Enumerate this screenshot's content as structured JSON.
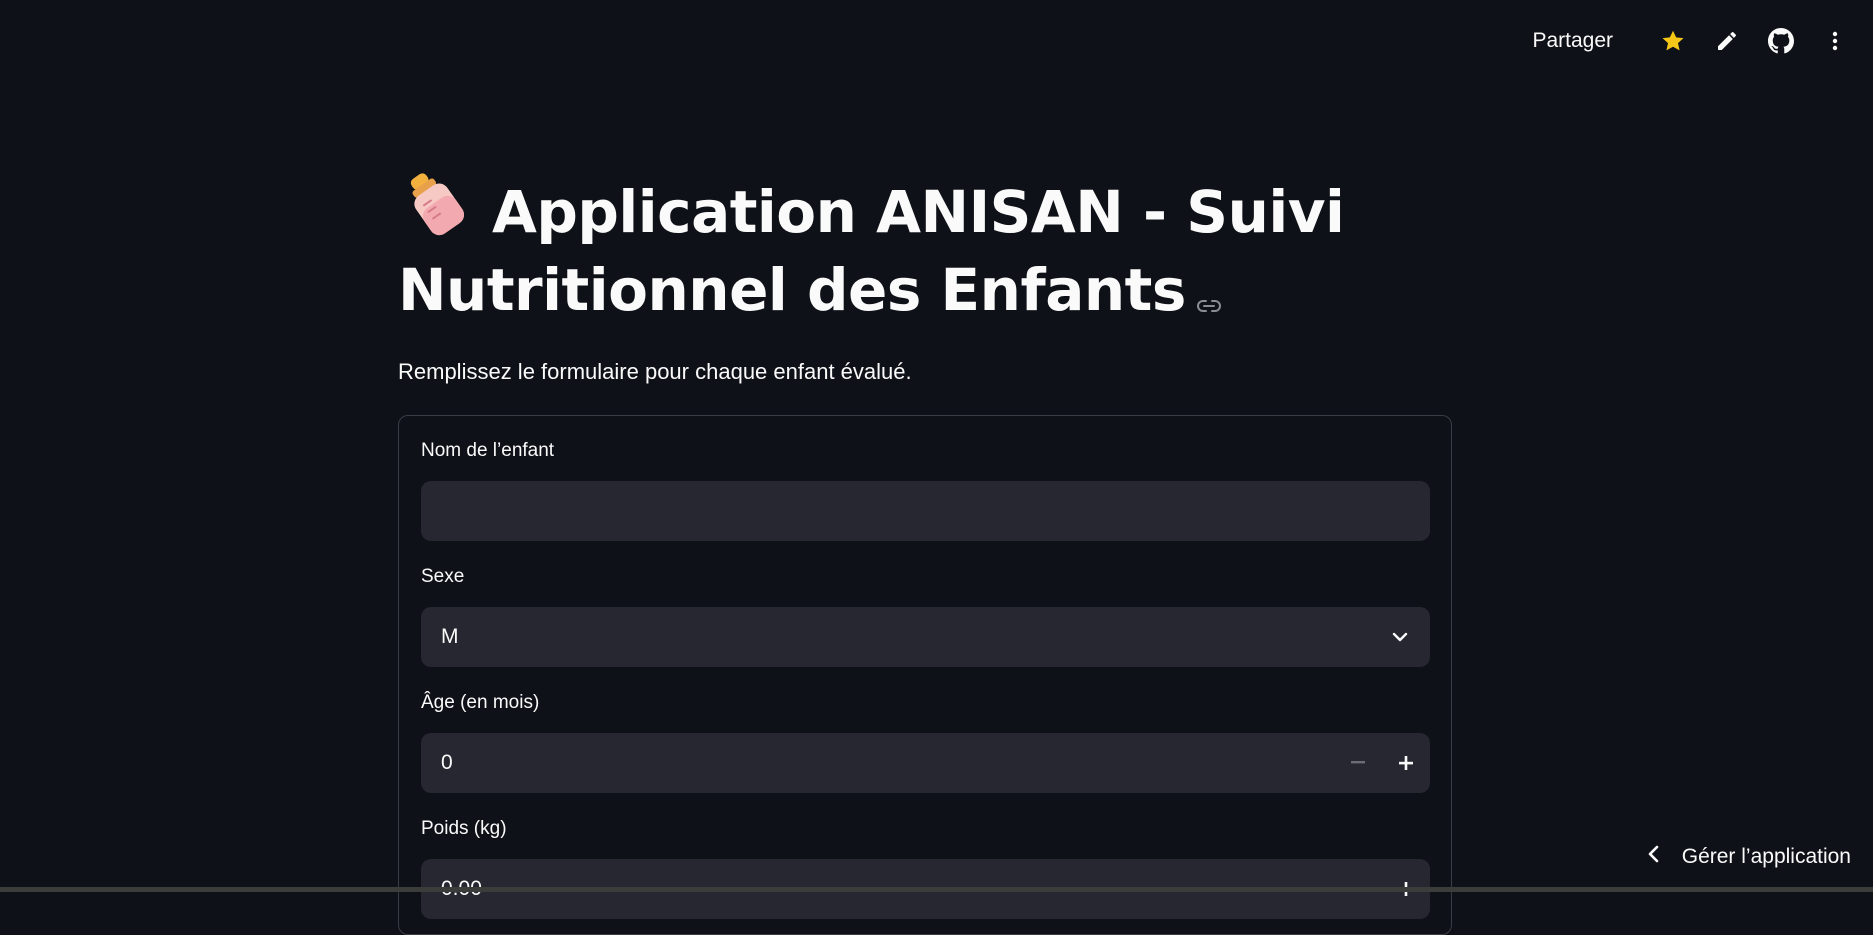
{
  "toolbar": {
    "share_label": "Partager",
    "icons": [
      "star-icon",
      "edit-icon",
      "github-icon",
      "more-vertical-icon"
    ],
    "star_color": "#f5c518"
  },
  "page": {
    "title_line1": "Application ANISAN - Suivi",
    "title_line2": "Nutritionnel des Enfants",
    "subtitle": "Remplissez le formulaire pour chaque enfant évalué."
  },
  "form": {
    "name_label": "Nom de l’enfant",
    "name_value": "",
    "sex_label": "Sexe",
    "sex_value": "M",
    "age_label": "Âge (en mois)",
    "age_value": "0",
    "weight_label": "Poids (kg)",
    "weight_value": "0.00"
  },
  "footer": {
    "manage_label": "Gérer l’application"
  },
  "colors": {
    "background": "#0e1117",
    "input_bg": "#262730",
    "border": "#3a3d46",
    "text": "#fafafa"
  }
}
